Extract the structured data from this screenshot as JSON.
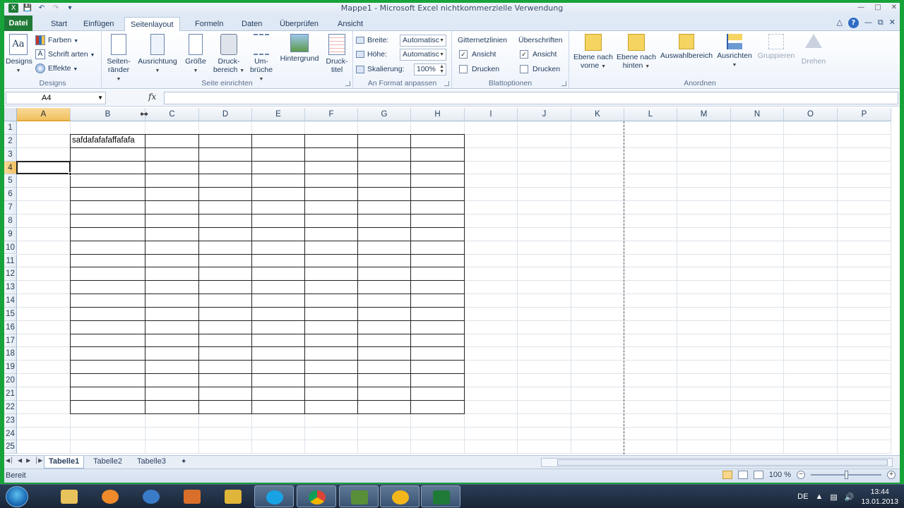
{
  "window": {
    "title": "Mappe1  -  Microsoft Excel nichtkommerzielle Verwendung"
  },
  "tabs": {
    "file": "Datei",
    "items": [
      "Start",
      "Einfügen",
      "Seitenlayout",
      "Formeln",
      "Daten",
      "Überprüfen",
      "Ansicht"
    ],
    "active": "Seitenlayout"
  },
  "ribbon": {
    "designs": {
      "label": "Designs",
      "button": "Designs",
      "colors": "Farben",
      "fonts": "Schrift arten",
      "effects": "Effekte"
    },
    "page_setup": {
      "label": "Seite einrichten",
      "margins": [
        "Seiten-",
        "ränder"
      ],
      "orientation": "Ausrichtung",
      "size": "Größe",
      "print_area": [
        "Druck-",
        "bereich"
      ],
      "breaks": [
        "Um-",
        "brüche"
      ],
      "background": "Hintergrund",
      "print_titles": [
        "Druck-",
        "titel"
      ]
    },
    "scale_to_fit": {
      "label": "An Format anpassen",
      "width_label": "Breite:",
      "width_value": "Automatisch",
      "height_label": "Höhe:",
      "height_value": "Automatisch",
      "scale_label": "Skalierung:",
      "scale_value": "100%"
    },
    "sheet_options": {
      "label": "Blattoptionen",
      "gridlines": "Gitternetzlinien",
      "headings": "Überschriften",
      "view": "Ansicht",
      "print": "Drucken",
      "gridlines_view": true,
      "gridlines_print": false,
      "headings_view": true,
      "headings_print": false
    },
    "arrange": {
      "label": "Anordnen",
      "bring_forward": [
        "Ebene nach",
        "vorne"
      ],
      "send_backward": [
        "Ebene nach",
        "hinten"
      ],
      "selection_pane": "Auswahlbereich",
      "align": "Ausrichten",
      "group": "Gruppieren",
      "rotate": "Drehen"
    }
  },
  "formula_bar": {
    "name_box": "A4",
    "fx": "fx",
    "formula": ""
  },
  "sheet": {
    "columns": [
      "A",
      "B",
      "C",
      "D",
      "E",
      "F",
      "G",
      "H",
      "I",
      "J",
      "K",
      "L",
      "M",
      "N",
      "O",
      "P"
    ],
    "selected_column": "A",
    "rows": [
      "1",
      "2",
      "3",
      "4",
      "5",
      "6",
      "7",
      "8",
      "9",
      "10",
      "11",
      "12",
      "13",
      "14",
      "15",
      "16",
      "17",
      "18",
      "19",
      "20",
      "21",
      "22",
      "23",
      "24",
      "25"
    ],
    "selected_row": "4",
    "active_cell": "A4",
    "cells": {
      "B2": "safdafafafaffafafa"
    },
    "bordered_range": "B2:H22"
  },
  "sheet_tabs": [
    "Tabelle1",
    "Tabelle2",
    "Tabelle3"
  ],
  "active_sheet": "Tabelle1",
  "status": {
    "mode": "Bereit",
    "zoom": "100 %"
  },
  "taskbar": {
    "lang": "DE",
    "time": "13:44",
    "date": "13.01.2013"
  },
  "colors": {
    "frame": "#18a33a",
    "file_tab": "#1f7a37",
    "selection_header": "#f1c15f"
  }
}
